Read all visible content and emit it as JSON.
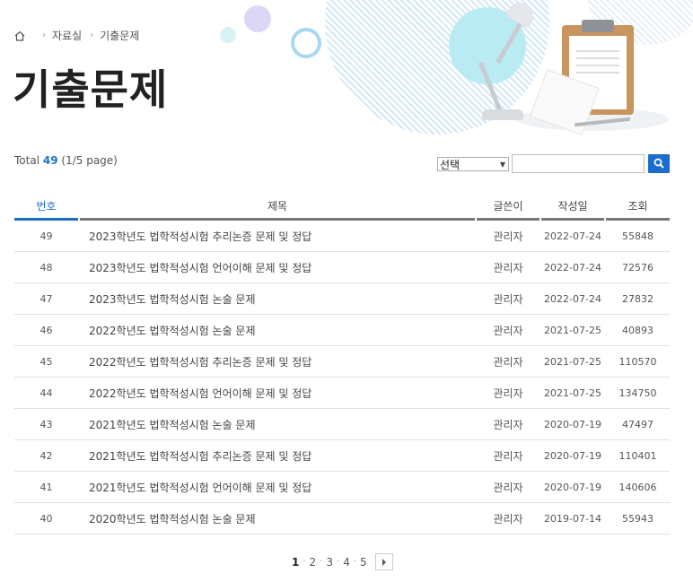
{
  "breadcrumb": {
    "home_icon": "home-icon",
    "items": [
      "자료실",
      "기출문제"
    ]
  },
  "page_title": "기출문제",
  "total": {
    "label": "Total",
    "count": "49",
    "pages": "(1/5 page)"
  },
  "search": {
    "select_value": "선택",
    "input_value": "",
    "button_icon": "search-icon",
    "accent": "#1a6dcd"
  },
  "table": {
    "headers": [
      "번호",
      "제목",
      "글쓴이",
      "작성일",
      "조회"
    ],
    "rows": [
      {
        "num": "49",
        "title": "2023학년도 법학적성시험 추리논증 문제 및 정답",
        "writer": "관리자",
        "date": "2022-07-24",
        "views": "55848"
      },
      {
        "num": "48",
        "title": "2023학년도 법학적성시험 언어이해 문제 및 정답",
        "writer": "관리자",
        "date": "2022-07-24",
        "views": "72576"
      },
      {
        "num": "47",
        "title": "2023학년도 법학적성시험 논술 문제",
        "writer": "관리자",
        "date": "2022-07-24",
        "views": "27832"
      },
      {
        "num": "46",
        "title": "2022학년도 법학적성시험 논술 문제",
        "writer": "관리자",
        "date": "2021-07-25",
        "views": "40893"
      },
      {
        "num": "45",
        "title": "2022학년도 법학적성시험 추리논증 문제 및 정답",
        "writer": "관리자",
        "date": "2021-07-25",
        "views": "110570"
      },
      {
        "num": "44",
        "title": "2022학년도 법학적성시험 언어이해 문제 및 정답",
        "writer": "관리자",
        "date": "2021-07-25",
        "views": "134750"
      },
      {
        "num": "43",
        "title": "2021학년도 법학적성시험 논술 문제",
        "writer": "관리자",
        "date": "2020-07-19",
        "views": "47497"
      },
      {
        "num": "42",
        "title": "2021학년도 법학적성시험 추리논증 문제 및 정답",
        "writer": "관리자",
        "date": "2020-07-19",
        "views": "110401"
      },
      {
        "num": "41",
        "title": "2021학년도 법학적성시험 언어이해 문제 및 정답",
        "writer": "관리자",
        "date": "2020-07-19",
        "views": "140606"
      },
      {
        "num": "40",
        "title": "2020학년도 법학적성시험 논술 문제",
        "writer": "관리자",
        "date": "2019-07-14",
        "views": "55943"
      }
    ]
  },
  "pagination": {
    "pages": [
      "1",
      "2",
      "3",
      "4",
      "5"
    ],
    "current": "1",
    "next_icon": "next-arrow-icon"
  }
}
